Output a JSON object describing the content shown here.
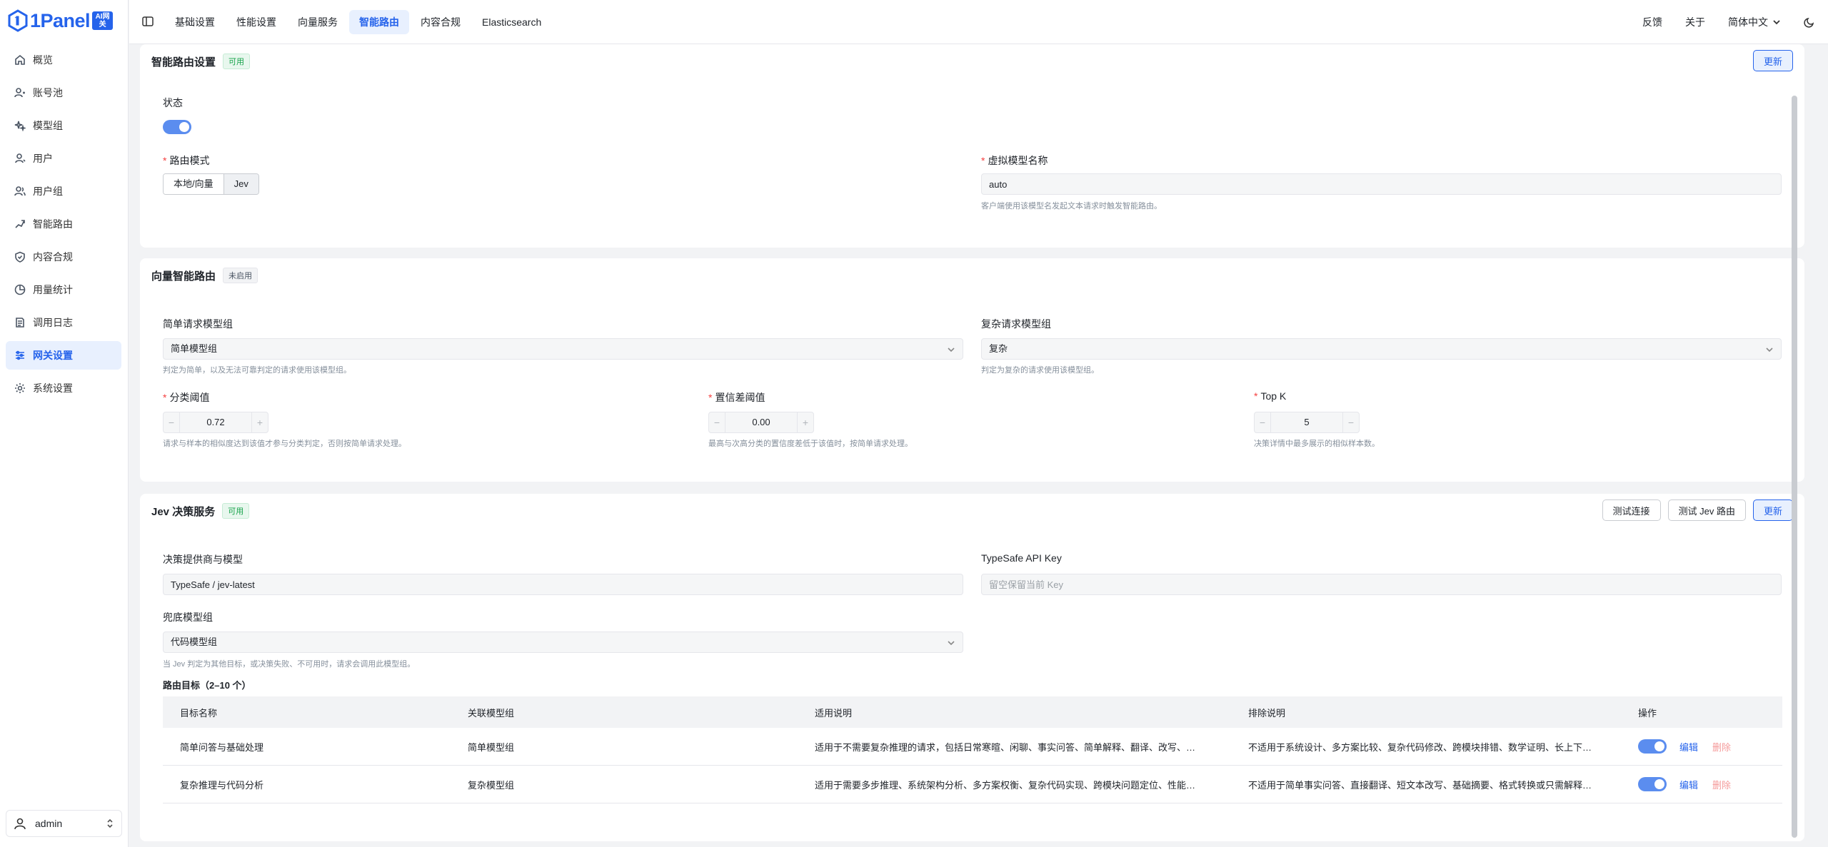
{
  "brand": {
    "name": "1Panel",
    "badge": "AI网关"
  },
  "sidebar": {
    "items": [
      {
        "label": "概览",
        "icon": "home-icon"
      },
      {
        "label": "账号池",
        "icon": "account-pool-icon"
      },
      {
        "label": "模型组",
        "icon": "sparkles-icon"
      },
      {
        "label": "用户",
        "icon": "user-icon"
      },
      {
        "label": "用户组",
        "icon": "users-icon"
      },
      {
        "label": "智能路由",
        "icon": "route-icon"
      },
      {
        "label": "内容合规",
        "icon": "shield-icon"
      },
      {
        "label": "用量统计",
        "icon": "chart-icon"
      },
      {
        "label": "调用日志",
        "icon": "log-icon"
      },
      {
        "label": "网关设置",
        "icon": "sliders-icon",
        "active": true
      },
      {
        "label": "系统设置",
        "icon": "gear-icon"
      }
    ],
    "user": "admin"
  },
  "topbar": {
    "tabs": [
      "基础设置",
      "性能设置",
      "向量服务",
      "智能路由",
      "内容合规",
      "Elasticsearch"
    ],
    "active_tab": "智能路由",
    "feedback": "反馈",
    "about": "关于",
    "language": "简体中文"
  },
  "routing": {
    "title": "智能路由设置",
    "badge": "可用",
    "update_btn": "更新",
    "status_label": "状态",
    "status_on": true,
    "mode_label": "路由模式",
    "mode_options": [
      "本地/向量",
      "Jev"
    ],
    "mode_selected": "Jev",
    "virtual_label": "虚拟模型名称",
    "virtual_value": "auto",
    "virtual_hint": "客户端使用该模型名发起文本请求时触发智能路由。"
  },
  "vector": {
    "title": "向量智能路由",
    "badge": "未启用",
    "simple_label": "简单请求模型组",
    "simple_value": "简单模型组",
    "simple_hint": "判定为简单，以及无法可靠判定的请求使用该模型组。",
    "complex_label": "复杂请求模型组",
    "complex_value": "复杂",
    "complex_hint": "判定为复杂的请求使用该模型组。",
    "threshold_label": "分类阈值",
    "threshold_value": "0.72",
    "threshold_hint": "请求与样本的相似度达到该值才参与分类判定，否则按简单请求处理。",
    "margin_label": "置信差阈值",
    "margin_value": "0.00",
    "margin_hint": "最高与次高分类的置信度差低于该值时，按简单请求处理。",
    "topk_label": "Top K",
    "topk_value": "5",
    "topk_hint": "决策详情中最多展示的相似样本数。"
  },
  "jev": {
    "title": "Jev 决策服务",
    "badge": "可用",
    "test_conn_btn": "测试连接",
    "test_route_btn": "测试 Jev 路由",
    "update_btn": "更新",
    "provider_label": "决策提供商与模型",
    "provider_value": "TypeSafe / jev-latest",
    "apikey_label": "TypeSafe API Key",
    "apikey_placeholder": "留空保留当前 Key",
    "fallback_label": "兜底模型组",
    "fallback_value": "代码模型组",
    "fallback_hint": "当 Jev 判定为其他目标，或决策失败、不可用时，请求会调用此模型组。",
    "targets_title": "路由目标（2–10 个）",
    "columns": [
      "目标名称",
      "关联模型组",
      "适用说明",
      "排除说明",
      "操作"
    ],
    "rows": [
      {
        "name": "简单问答与基础处理",
        "group": "简单模型组",
        "apply": "适用于不需要复杂推理的请求，包括日常寒暄、闲聊、事实问答、简单解释、翻译、改写、…",
        "exclude": "不适用于系统设计、多方案比较、复杂代码修改、跨模块排错、数学证明、长上下…",
        "enabled": true,
        "edit": "编辑",
        "delete": "删除"
      },
      {
        "name": "复杂推理与代码分析",
        "group": "复杂模型组",
        "apply": "适用于需要多步推理、系统架构分析、多方案权衡、复杂代码实现、跨模块问题定位、性能…",
        "exclude": "不适用于简单事实问答、直接翻译、短文本改写、基础摘要、格式转换或只需解释…",
        "enabled": true,
        "edit": "编辑",
        "delete": "删除"
      }
    ]
  },
  "colors": {
    "accent": "#2563eb",
    "toggle": "#5b8def",
    "success": "#16a34a",
    "danger": "#f59a9a"
  }
}
